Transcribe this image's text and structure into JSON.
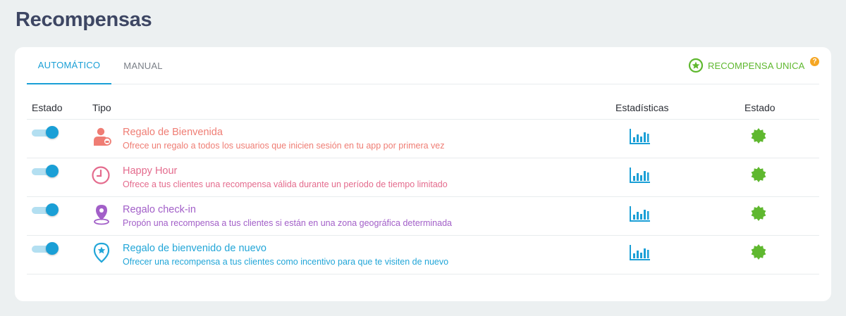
{
  "page_title": "Recompensas",
  "tabs": [
    {
      "label": "AUTOMÁTICO",
      "active": true
    },
    {
      "label": "MANUAL",
      "active": false
    }
  ],
  "unique_reward": {
    "label": "RECOMPENSA UNICA",
    "icon": "star-circle-icon",
    "color": "#5fb82f"
  },
  "help": {
    "label": "?",
    "color": "#f5a623"
  },
  "columns": {
    "estado": "Estado",
    "tipo": "Tipo",
    "estadisticas": "Estadísticas",
    "estado_final": "Estado"
  },
  "rows": [
    {
      "enabled": true,
      "icon": "user-gift-icon",
      "color": "#ef7d74",
      "title": "Regalo de Bienvenida",
      "description": "Ofrece un regalo a todos los usuarios que inicien sesión en tu app por primera vez"
    },
    {
      "enabled": true,
      "icon": "clock-icon",
      "color": "#e46b8d",
      "title": "Happy Hour",
      "description": "Ofrece a tus clientes una recompensa válida durante un período de tiempo limitado"
    },
    {
      "enabled": true,
      "icon": "location-pin-icon",
      "color": "#a25fc8",
      "title": "Regalo check-in",
      "description": "Propón una recompensa a tus clientes si están en una zona geográfica determinada"
    },
    {
      "enabled": true,
      "icon": "star-pin-icon",
      "color": "#22a6d8",
      "title": "Regalo de bienvenido de nuevo",
      "description": "Ofrecer una recompensa a tus clientes como incentivo para que te visiten de nuevo"
    }
  ],
  "stats_icon": "bar-chart-icon",
  "stats_color": "#1a9fd6",
  "status_icon": "active-badge-icon",
  "status_color": "#5fb82f"
}
